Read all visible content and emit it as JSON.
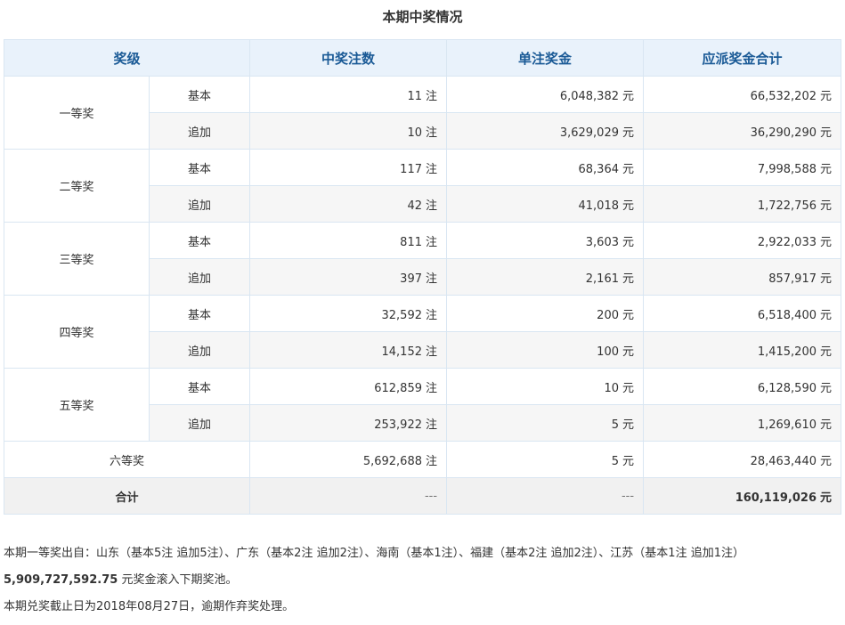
{
  "title": "本期中奖情况",
  "headers": [
    "奖级",
    "中奖注数",
    "单注奖金",
    "应派奖金合计"
  ],
  "unit_bet": "注",
  "unit_money": "元",
  "prizes": [
    {
      "level": "一等奖",
      "rows": [
        {
          "type": "基本",
          "count": "11",
          "single": "6,048,382",
          "total": "66,532,202"
        },
        {
          "type": "追加",
          "count": "10",
          "single": "3,629,029",
          "total": "36,290,290"
        }
      ]
    },
    {
      "level": "二等奖",
      "rows": [
        {
          "type": "基本",
          "count": "117",
          "single": "68,364",
          "total": "7,998,588"
        },
        {
          "type": "追加",
          "count": "42",
          "single": "41,018",
          "total": "1,722,756"
        }
      ]
    },
    {
      "level": "三等奖",
      "rows": [
        {
          "type": "基本",
          "count": "811",
          "single": "3,603",
          "total": "2,922,033"
        },
        {
          "type": "追加",
          "count": "397",
          "single": "2,161",
          "total": "857,917"
        }
      ]
    },
    {
      "level": "四等奖",
      "rows": [
        {
          "type": "基本",
          "count": "32,592",
          "single": "200",
          "total": "6,518,400"
        },
        {
          "type": "追加",
          "count": "14,152",
          "single": "100",
          "total": "1,415,200"
        }
      ]
    },
    {
      "level": "五等奖",
      "rows": [
        {
          "type": "基本",
          "count": "612,859",
          "single": "10",
          "total": "6,128,590"
        },
        {
          "type": "追加",
          "count": "253,922",
          "single": "5",
          "total": "1,269,610"
        }
      ]
    }
  ],
  "sixth": {
    "level": "六等奖",
    "count": "5,692,688",
    "single": "5",
    "total": "28,463,440"
  },
  "summary": {
    "label": "合计",
    "count": "---",
    "single": "---",
    "total": "160,119,026"
  },
  "notes": {
    "line1": "本期一等奖出自：山东（基本5注 追加5注）、广东（基本2注 追加2注）、海南（基本1注）、福建（基本2注 追加2注）、江苏（基本1注 追加1注）",
    "rollover_amount": "5,909,727,592.75",
    "rollover_text": " 元奖金滚入下期奖池。",
    "line3": "本期兑奖截止日为2018年08月27日，逾期作弃奖处理。"
  }
}
